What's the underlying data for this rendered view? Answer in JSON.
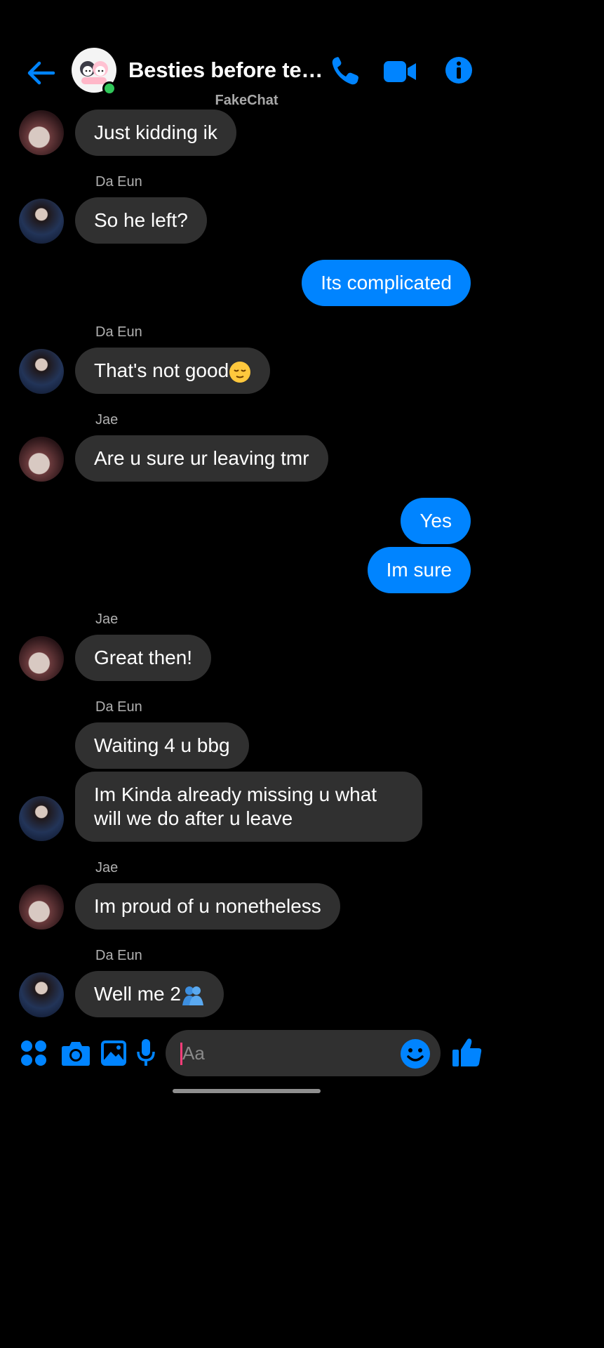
{
  "header": {
    "title": "Besties before te…",
    "watermark": "FakeChat",
    "icons": [
      "back-arrow-icon",
      "phone-icon",
      "video-camera-icon",
      "info-icon"
    ],
    "accent": "#0084ff"
  },
  "messages": [
    {
      "sender": "",
      "text": "Just kidding ik",
      "from": "other",
      "avatar": "Jae"
    },
    {
      "sender": "Da Eun",
      "text": "So he left?",
      "from": "other",
      "avatar": "Da Eun"
    },
    {
      "sender": "",
      "text": "Its complicated",
      "from": "me"
    },
    {
      "sender": "Da Eun",
      "text": "That's not good",
      "emoji": "relieved-face-emoji",
      "from": "other",
      "avatar": "Da Eun"
    },
    {
      "sender": "Jae",
      "text": "Are u sure ur leaving tmr",
      "from": "other",
      "avatar": "Jae"
    },
    {
      "sender": "",
      "text": "Yes",
      "from": "me"
    },
    {
      "sender": "",
      "text": "Im sure",
      "from": "me"
    },
    {
      "sender": "Jae",
      "text": "Great then!",
      "from": "other",
      "avatar": "Jae"
    },
    {
      "sender": "Da Eun",
      "text": "Waiting 4 u bbg",
      "from": "other"
    },
    {
      "sender": "",
      "text": "Im Kinda already missing u what will we do after u leave",
      "from": "other",
      "avatar": "Da Eun"
    },
    {
      "sender": "Jae",
      "text": "Im proud of u nonetheless",
      "from": "other",
      "avatar": "Jae"
    },
    {
      "sender": "Da Eun",
      "text": "Well me 2",
      "emoji": "people-hugging-emoji",
      "from": "other",
      "avatar": "Da Eun"
    }
  ],
  "composer": {
    "placeholder": "Aa",
    "icons": [
      "apps-grid-icon",
      "camera-icon",
      "gallery-icon",
      "microphone-icon",
      "emoji-icon",
      "thumbs-up-icon"
    ]
  }
}
